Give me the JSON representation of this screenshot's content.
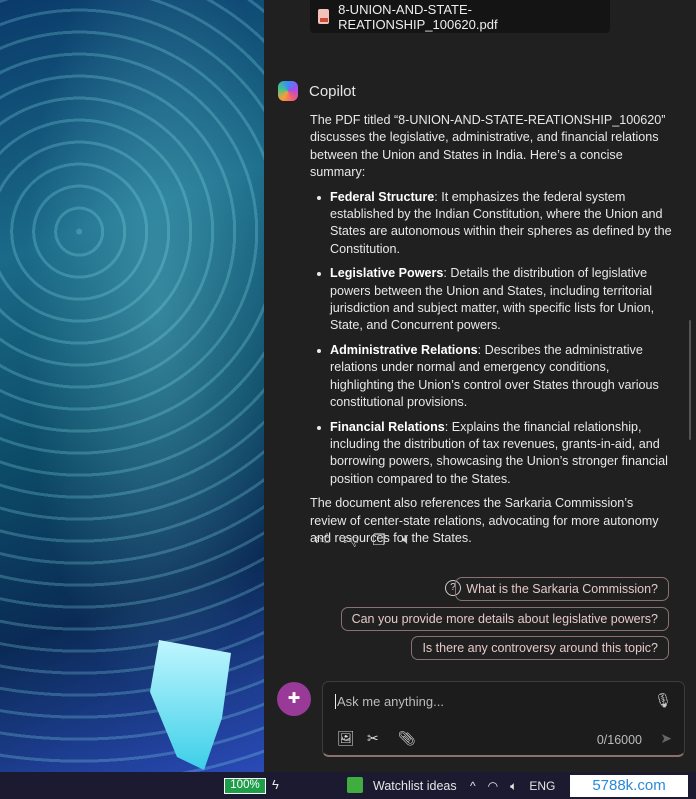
{
  "attachment": {
    "filename": "8-UNION-AND-STATE-REATIONSHIP_100620.pdf",
    "icon": "pdf-icon"
  },
  "assistant": {
    "name": "Copilot"
  },
  "message": {
    "intro": "The PDF titled “8-UNION-AND-STATE-REATIONSHIP_100620” discusses the legislative, administrative, and financial relations between the Union and States in India. Here’s a concise summary:",
    "bullets": [
      {
        "title": "Federal Structure",
        "text": ": It emphasizes the federal system established by the Indian Constitution, where the Union and States are autonomous within their spheres as defined by the Constitution."
      },
      {
        "title": "Legislative Powers",
        "text": ": Details the distribution of legislative powers between the Union and States, including territorial jurisdiction and subject matter, with specific lists for Union, State, and Concurrent powers."
      },
      {
        "title": "Administrative Relations",
        "text": ": Describes the administrative relations under normal and emergency conditions, highlighting the Union’s control over States through various constitutional provisions."
      },
      {
        "title": "Financial Relations",
        "text": ": Explains the financial relationship, including the distribution of tax revenues, grants-in-aid, and borrowing powers, showcasing the Union’s stronger financial position compared to the States."
      }
    ],
    "outro": "The document also references the Sarkaria Commission’s review of center-state relations, advocating for more autonomy and resources for the States."
  },
  "suggestions": [
    "What is the Sarkaria Commission?",
    "Can you provide more details about legislative powers?",
    "Is there any controversy around this topic?"
  ],
  "input": {
    "placeholder": "Ask me anything...",
    "counter": "0/16000"
  },
  "taskbar": {
    "battery": "100%",
    "widget": "Watchlist ideas",
    "language": "ENG"
  },
  "watermark": "5788k.com"
}
